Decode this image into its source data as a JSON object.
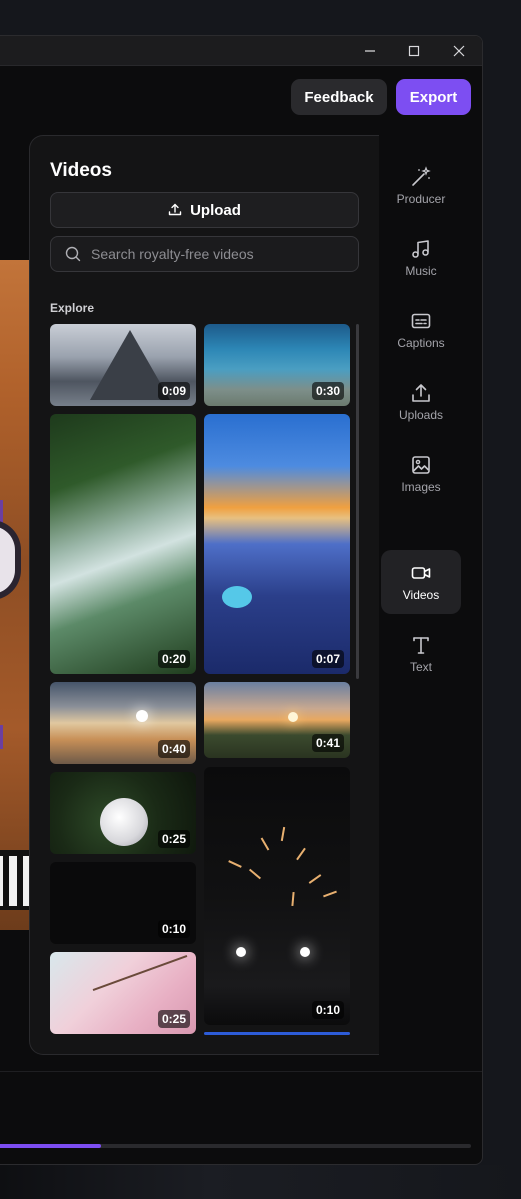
{
  "window": {
    "controls": {
      "minimize": "minimize",
      "maximize": "maximize",
      "close": "close"
    }
  },
  "header": {
    "feedback_label": "Feedback",
    "export_label": "Export",
    "accent_color": "#7d4ef2"
  },
  "panel": {
    "title": "Videos",
    "upload_label": "Upload",
    "search_placeholder": "Search royalty-free videos",
    "section_label": "Explore",
    "videos": [
      {
        "duration": "0:09"
      },
      {
        "duration": "0:30"
      },
      {
        "duration": "0:20"
      },
      {
        "duration": "0:07"
      },
      {
        "duration": "0:40"
      },
      {
        "duration": "0:41"
      },
      {
        "duration": "0:25"
      },
      {
        "duration": "0:10"
      },
      {
        "duration": "0:10"
      },
      {
        "duration": "0:25"
      }
    ]
  },
  "sidebar": {
    "items": [
      {
        "label": "Producer",
        "icon": "magic-wand-icon"
      },
      {
        "label": "Music",
        "icon": "music-note-icon"
      },
      {
        "label": "Captions",
        "icon": "captions-icon"
      },
      {
        "label": "Uploads",
        "icon": "upload-icon"
      },
      {
        "label": "Images",
        "icon": "image-icon"
      },
      {
        "label": "Videos",
        "icon": "video-camera-icon",
        "active": true
      },
      {
        "label": "Text",
        "icon": "text-icon"
      }
    ]
  },
  "timeline": {
    "progress_fraction": 0.23
  }
}
